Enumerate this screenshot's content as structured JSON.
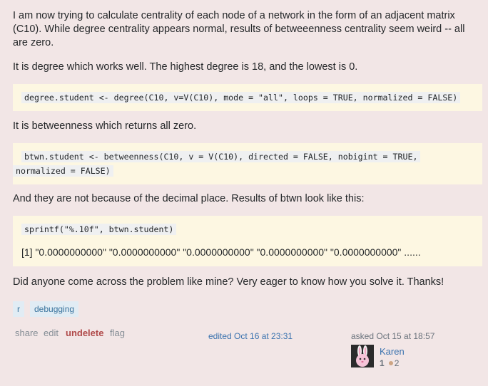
{
  "post": {
    "intro": "I am now trying to calculate centrality of each node of a network in the form of an adjacent matrix (C10). While degree centrality appears normal, results of betweeenness centrality seem weird -- all are zero.",
    "degree_text": "It is degree which works well. The highest degree is 18, and the lowest is 0.",
    "degree_code": "degree.student <- degree(C10, v=V(C10), mode = \"all\", loops = TRUE, normalized = FALSE)",
    "btwn_text": "It is betweenness which returns all zero.",
    "btwn_code_line1": "btwn.student <- betweenness(C10, v = V(C10), directed = FALSE, nobigint = TRUE,",
    "btwn_code_line2": "normalized = FALSE)",
    "decimal_text": "And they are not because of the decimal place. Results of btwn look like this:",
    "sprintf_code": "sprintf(\"%.10f\", btwn.student)",
    "output_text": "[1] \"0.0000000000\" \"0.0000000000\" \"0.0000000000\" \"0.0000000000\" \"0.0000000000\" ......",
    "closing": "Did anyone come across the problem like mine? Very eager to know how you solve it. Thanks!"
  },
  "tags": [
    "r",
    "debugging"
  ],
  "menu": {
    "share": "share",
    "edit": "edit",
    "undelete": "undelete",
    "flag": "flag"
  },
  "edited": "edited Oct 16 at 23:31",
  "asked": "asked Oct 15 at 18:57",
  "user": {
    "name": "Karen",
    "reputation": "1",
    "bronze": "2",
    "bronze_color": "#cda584"
  }
}
